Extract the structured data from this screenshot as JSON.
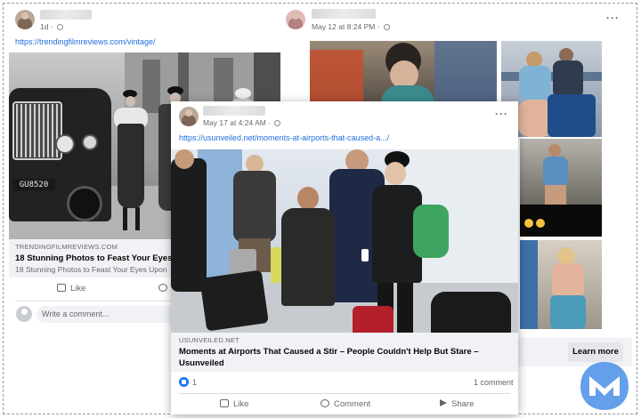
{
  "post_left": {
    "time": "1d",
    "link": "https://trendingfilmreviews.com/vintage/",
    "caption": {
      "domain": "TRENDINGFILMREVIEWS.COM",
      "title": "18 Stunning Photos to Feast Your Eyes Upon",
      "subtitle": "18 Stunning Photos to Feast Your Eyes Upon"
    },
    "car_plate": "GU8520",
    "like_label": "Like",
    "comment_placeholder": "Write a comment..."
  },
  "post_right": {
    "time": "May 12 at 8:24 PM",
    "more": "···",
    "cta": "Learn more"
  },
  "post_front": {
    "time": "May 17 at 4:24 AM",
    "more": "···",
    "link": "https://usunveiled.net/moments-at-airports-that-caused-a.../",
    "caption": {
      "domain": "USUNVEILED.NET",
      "title": "Moments at Airports That Caused a Stir – People Couldn't Help But Stare –",
      "title2": "Usunveiled"
    },
    "reactions": "1",
    "comments": "1 comment",
    "actions": {
      "like": "Like",
      "comment": "Comment",
      "share": "Share"
    }
  },
  "colors": {
    "link": "#216fdb",
    "malwarebytes": "#4a8fe7",
    "facebook_blue": "#1877f2"
  },
  "watermark": "malwarebytes-logo"
}
